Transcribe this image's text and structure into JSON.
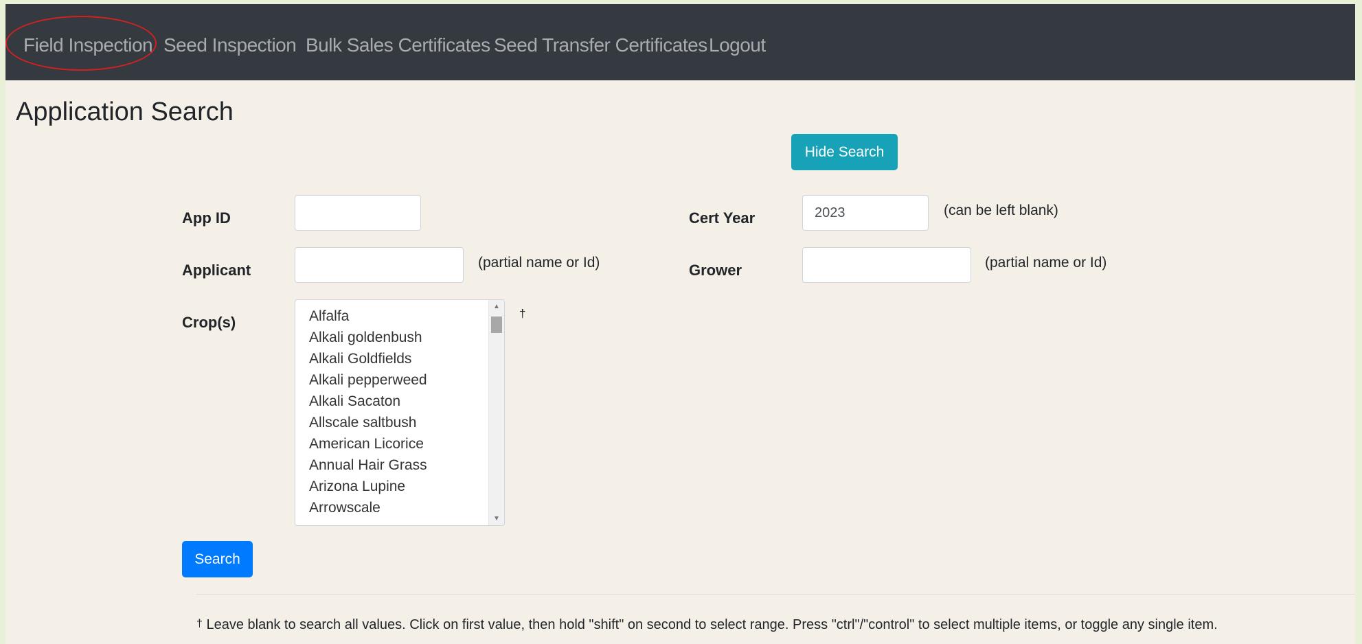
{
  "nav": {
    "items": [
      "Field Inspection",
      "Seed Inspection",
      "Bulk Sales Certificates",
      "Seed Transfer Certificates",
      "Logout"
    ]
  },
  "page_title": "Application Search",
  "buttons": {
    "hide_search": "Hide Search",
    "search": "Search"
  },
  "form": {
    "app_id": {
      "label": "App ID",
      "value": ""
    },
    "cert_year": {
      "label": "Cert Year",
      "value": "2023",
      "hint": "(can be left blank)"
    },
    "applicant": {
      "label": "Applicant",
      "value": "",
      "hint": "(partial name or Id)"
    },
    "grower": {
      "label": "Grower",
      "value": "",
      "hint": "(partial name or Id)"
    },
    "crops": {
      "label": "Crop(s)",
      "marker": "†",
      "options": [
        "Alfalfa",
        "Alkali goldenbush",
        "Alkali Goldfields",
        "Alkali pepperweed",
        "Alkali Sacaton",
        "Allscale saltbush",
        "American Licorice",
        "Annual Hair Grass",
        "Arizona Lupine",
        "Arrowscale"
      ]
    }
  },
  "footnote": {
    "marker": "†",
    "text": " Leave blank to search all values. Click on first value, then hold \"shift\" on second to select range. Press \"ctrl\"/\"control\" to select multiple items, or toggle any single item."
  }
}
